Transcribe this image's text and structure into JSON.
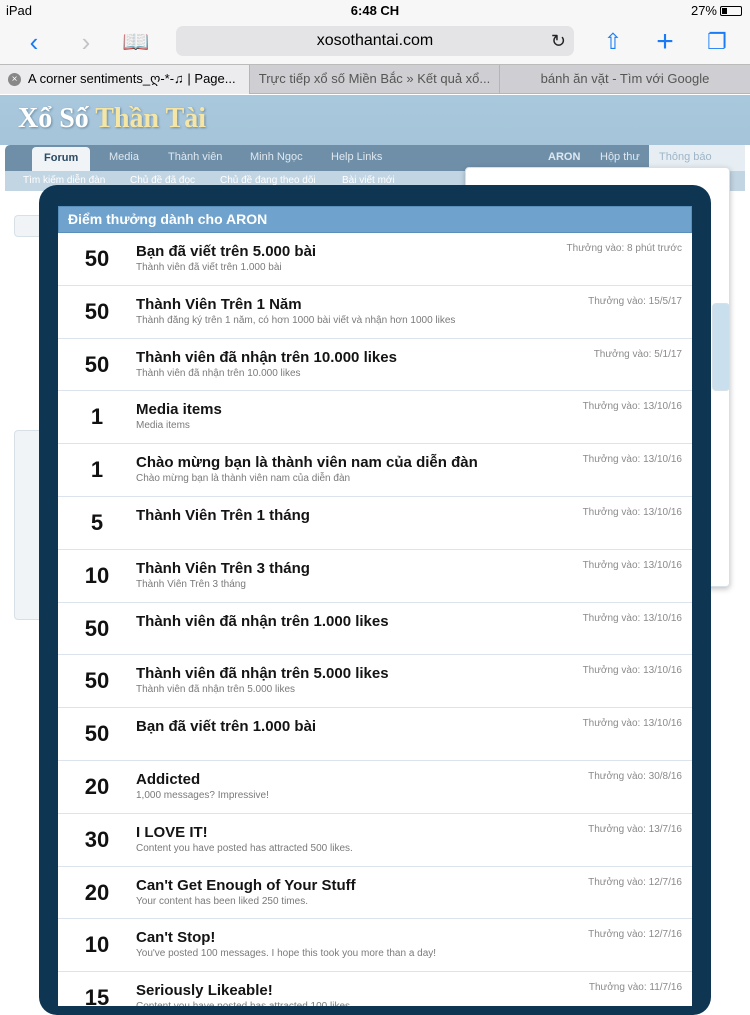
{
  "status": {
    "device": "iPad",
    "time": "6:48 CH",
    "battery": "27%"
  },
  "toolbar": {
    "url": "xosothantai.com"
  },
  "tabs": [
    {
      "label": "A corner sentiments_ღ-*-♫ | Page..."
    },
    {
      "label": "Trực tiếp xổ số Miền Bắc » Kết quả xổ..."
    },
    {
      "label": "bánh ăn vặt - Tìm với Google"
    }
  ],
  "site": {
    "logo_a": "Xổ Số",
    "logo_b": "Thần Tài",
    "nav": [
      "Forum",
      "Media",
      "Thành viên",
      "Minh Ngọc",
      "Help Links"
    ],
    "user": "ARON",
    "inbox": "Hộp thư",
    "alerts": "Thông báo",
    "subnav": [
      "Tìm kiếm diễn đàn",
      "Chủ đề đã đọc",
      "Chủ đề đang theo dõi",
      "Bài viết mới"
    ]
  },
  "modal": {
    "title": "Điểm thưởng dành cho ARON",
    "trophies": [
      {
        "points": "50",
        "title": "Bạn đã viết trên 5.000 bài",
        "desc": "Thành viên đã viết trên 1.000 bài",
        "date": "Thưởng vào: 8 phút trước"
      },
      {
        "points": "50",
        "title": "Thành Viên Trên 1 Năm",
        "desc": "Thành đăng ký trên 1 năm, có hơn 1000 bài viết và nhận hơn 1000 likes",
        "date": "Thưởng vào: 15/5/17"
      },
      {
        "points": "50",
        "title": "Thành viên đã nhận trên 10.000 likes",
        "desc": "Thành viên đã nhận trên 10.000 likes",
        "date": "Thưởng vào: 5/1/17"
      },
      {
        "points": "1",
        "title": "Media items",
        "desc": "Media items",
        "date": "Thưởng vào: 13/10/16"
      },
      {
        "points": "1",
        "title": "Chào mừng bạn là thành viên nam của diễn đàn",
        "desc": "Chào mừng bạn là thành viên nam của diễn đàn",
        "date": "Thưởng vào: 13/10/16"
      },
      {
        "points": "5",
        "title": "Thành Viên Trên 1 tháng",
        "desc": "",
        "date": "Thưởng vào: 13/10/16"
      },
      {
        "points": "10",
        "title": "Thành Viên Trên 3 tháng",
        "desc": "Thành Viên Trên 3 tháng",
        "date": "Thưởng vào: 13/10/16"
      },
      {
        "points": "50",
        "title": "Thành viên đã nhận trên 1.000 likes",
        "desc": "",
        "date": "Thưởng vào: 13/10/16"
      },
      {
        "points": "50",
        "title": "Thành viên đã nhận trên 5.000 likes",
        "desc": "Thành viên đã nhận trên 5.000 likes",
        "date": "Thưởng vào: 13/10/16"
      },
      {
        "points": "50",
        "title": "Bạn đã viết trên 1.000 bài",
        "desc": "",
        "date": "Thưởng vào: 13/10/16"
      },
      {
        "points": "20",
        "title": "Addicted",
        "desc": "1,000 messages? Impressive!",
        "date": "Thưởng vào: 30/8/16"
      },
      {
        "points": "30",
        "title": "I LOVE IT!",
        "desc": "Content you have posted has attracted 500 likes.",
        "date": "Thưởng vào: 13/7/16"
      },
      {
        "points": "20",
        "title": "Can't Get Enough of Your Stuff",
        "desc": "Your content has been liked 250 times.",
        "date": "Thưởng vào: 12/7/16"
      },
      {
        "points": "10",
        "title": "Can't Stop!",
        "desc": "You've posted 100 messages. I hope this took you more than a day!",
        "date": "Thưởng vào: 12/7/16"
      },
      {
        "points": "15",
        "title": "Seriously Likeable!",
        "desc": "Content you have posted has attracted 100 likes.",
        "date": "Thưởng vào: 11/7/16"
      }
    ]
  }
}
